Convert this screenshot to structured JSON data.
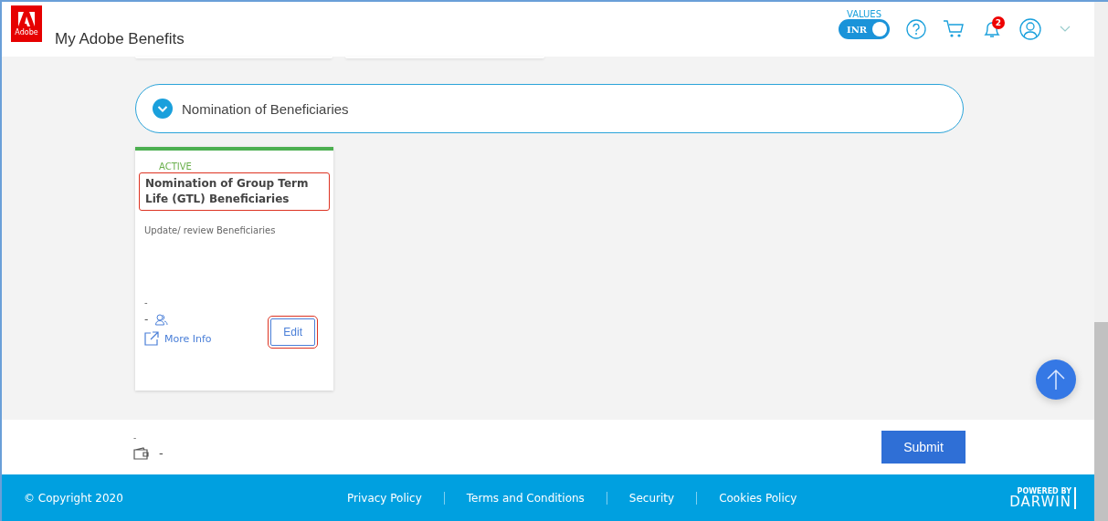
{
  "header": {
    "logo_text": "Adobe",
    "title": "My Adobe Benefits",
    "values_label": "VALUES",
    "currency_toggle": {
      "label": "INR",
      "on": true
    },
    "notifications_count": "2"
  },
  "section": {
    "title": "Nomination of Beneficiaries",
    "expanded": true
  },
  "cards": [
    {
      "status": "ACTIVE",
      "title": "Nomination of Group Term Life (GTL) Beneficiaries",
      "description": "Update/ review Beneficiaries",
      "line_1": "-",
      "line_2": "-",
      "more_info": "More Info",
      "action": "Edit"
    }
  ],
  "bottom_bar": {
    "line_1": "-",
    "wallet_value": "-",
    "submit": "Submit"
  },
  "footer": {
    "copyright": "© Copyright 2020",
    "links": [
      "Privacy Policy",
      "Terms and Conditions",
      "Security",
      "Cookies Policy"
    ],
    "powered_by": "POWERED BY",
    "brand": "DARWIN"
  }
}
